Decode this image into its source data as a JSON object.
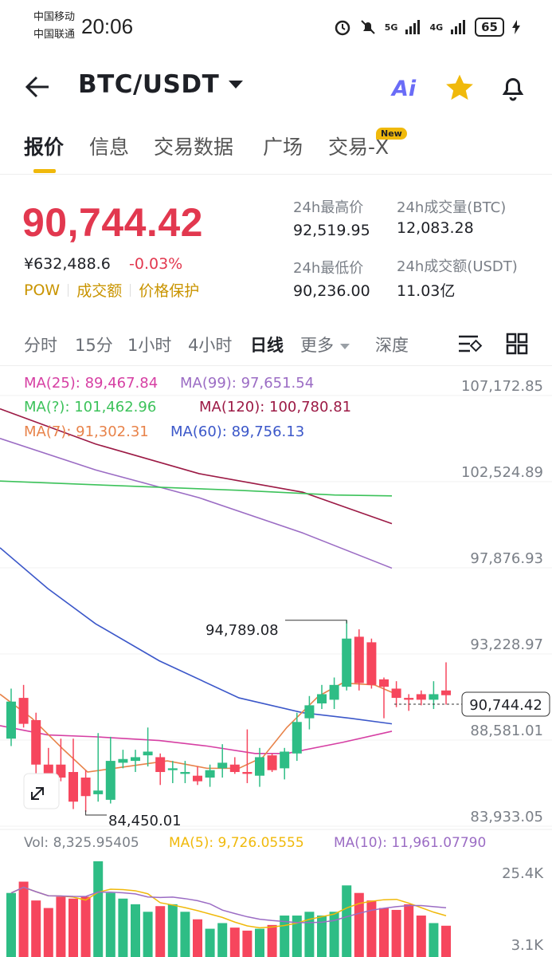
{
  "status_bar": {
    "carrier1": "中国移动",
    "carrier2": "中国联通",
    "time": "20:06",
    "net1": "5G",
    "net2": "4G",
    "battery": "65"
  },
  "header": {
    "pair": "BTC/USDT",
    "ai_label": "Ai",
    "icons": [
      "back-arrow-icon",
      "ai-icon",
      "star-icon",
      "bell-icon"
    ]
  },
  "tabs": [
    {
      "label": "报价",
      "active": true
    },
    {
      "label": "信息"
    },
    {
      "label": "交易数据"
    },
    {
      "label": "广场"
    },
    {
      "label": "交易-X",
      "badge": "New"
    }
  ],
  "price": {
    "last": "90,744.42",
    "cny": "¥632,488.6",
    "change": "-0.03%",
    "tags": [
      "POW",
      "成交额",
      "价格保护"
    ],
    "stats": {
      "high_label": "24h最高价",
      "high": "92,519.95",
      "low_label": "24h最低价",
      "low": "90,236.00",
      "vol_btc_label": "24h成交量(BTC)",
      "vol_btc": "12,083.28",
      "vol_usdt_label": "24h成交额(USDT)",
      "vol_usdt": "11.03亿"
    }
  },
  "intervals": [
    "分时",
    "15分",
    "1小时",
    "4小时",
    "日线",
    "更多",
    "深度"
  ],
  "active_interval": "日线",
  "ma_legend": {
    "ma25": "MA(25): 89,467.84",
    "ma99": "MA(99): 97,651.54",
    "ma_hidden": "MA(?): 101,462.96",
    "ma120": "MA(120): 100,780.81",
    "ma7": "MA(7): 91,302.31",
    "ma60": "MA(60): 89,756.13"
  },
  "colors": {
    "up": "#2ebd85",
    "down": "#f6465d",
    "accent": "#f0b90b",
    "ma7": "#e8834a",
    "ma25": "#d63fa3",
    "ma99": "#9b6cc4",
    "ma60": "#3b57c9",
    "ma120": "#9c1a45",
    "ma_green": "#3cc25a",
    "vol_ma5": "#f0b90b",
    "vol_ma10": "#9b6cc4"
  },
  "chart_data": {
    "type": "candlestick",
    "y_ticks": [
      "107,172.85",
      "102,524.89",
      "97,876.93",
      "93,228.97",
      "88,581.01",
      "83,933.05"
    ],
    "ylim": [
      83933.05,
      107172.85
    ],
    "annotations": {
      "high_label": "94,789.08",
      "low_label": "84,450.01",
      "current_price": "90,744.42"
    },
    "candles": [
      {
        "o": 88400,
        "h": 91100,
        "l": 88000,
        "c": 90400
      },
      {
        "o": 90600,
        "h": 91300,
        "l": 89000,
        "c": 89200
      },
      {
        "o": 89400,
        "h": 89800,
        "l": 86500,
        "c": 87000
      },
      {
        "o": 87000,
        "h": 87900,
        "l": 86100,
        "c": 86500
      },
      {
        "o": 87000,
        "h": 88400,
        "l": 86100,
        "c": 86300
      },
      {
        "o": 86600,
        "h": 88400,
        "l": 84600,
        "c": 85000
      },
      {
        "o": 86300,
        "h": 86700,
        "l": 84450.01,
        "c": 85300
      },
      {
        "o": 85400,
        "h": 88700,
        "l": 85000,
        "c": 85600
      },
      {
        "o": 85100,
        "h": 88500,
        "l": 84900,
        "c": 87200
      },
      {
        "o": 87100,
        "h": 87800,
        "l": 86800,
        "c": 87300
      },
      {
        "o": 87200,
        "h": 87800,
        "l": 86600,
        "c": 87400
      },
      {
        "o": 87500,
        "h": 89000,
        "l": 86900,
        "c": 87700
      },
      {
        "o": 87400,
        "h": 87600,
        "l": 85900,
        "c": 86600
      },
      {
        "o": 86700,
        "h": 87200,
        "l": 86000,
        "c": 86800
      },
      {
        "o": 86500,
        "h": 87200,
        "l": 86000,
        "c": 86600
      },
      {
        "o": 86400,
        "h": 86900,
        "l": 85900,
        "c": 86100
      },
      {
        "o": 86300,
        "h": 87000,
        "l": 85800,
        "c": 86700
      },
      {
        "o": 86800,
        "h": 88100,
        "l": 86300,
        "c": 87100
      },
      {
        "o": 87000,
        "h": 87400,
        "l": 86500,
        "c": 86600
      },
      {
        "o": 86600,
        "h": 88900,
        "l": 86000,
        "c": 86500
      },
      {
        "o": 86400,
        "h": 87900,
        "l": 85800,
        "c": 87400
      },
      {
        "o": 87500,
        "h": 87600,
        "l": 86600,
        "c": 86700
      },
      {
        "o": 86800,
        "h": 87900,
        "l": 86200,
        "c": 87700
      },
      {
        "o": 87600,
        "h": 89800,
        "l": 87200,
        "c": 89300
      },
      {
        "o": 89500,
        "h": 90700,
        "l": 88900,
        "c": 90200
      },
      {
        "o": 90300,
        "h": 91300,
        "l": 90000,
        "c": 90800
      },
      {
        "o": 90500,
        "h": 91700,
        "l": 90000,
        "c": 91300
      },
      {
        "o": 91200,
        "h": 94789.08,
        "l": 91000,
        "c": 93800
      },
      {
        "o": 93900,
        "h": 94300,
        "l": 91000,
        "c": 91400
      },
      {
        "o": 93600,
        "h": 93800,
        "l": 91100,
        "c": 91300
      },
      {
        "o": 91600,
        "h": 91700,
        "l": 89500,
        "c": 91200
      },
      {
        "o": 91100,
        "h": 91500,
        "l": 90100,
        "c": 90600
      },
      {
        "o": 90600,
        "h": 90800,
        "l": 89900,
        "c": 90500
      },
      {
        "o": 90800,
        "h": 91000,
        "l": 90200,
        "c": 90500
      },
      {
        "o": 90500,
        "h": 91500,
        "l": 90000,
        "c": 90800
      },
      {
        "o": 91000,
        "h": 92519.95,
        "l": 90236,
        "c": 90744.42
      }
    ],
    "volume": {
      "legend_vol": "Vol: 8,325.95405",
      "legend_ma5": "MA(5): 9,726.05555",
      "legend_ma10": "MA(10): 11,961.07790",
      "y_ticks": [
        "25.4K",
        "3.1K"
      ],
      "values": [
        17000,
        20000,
        15000,
        13000,
        16000,
        15500,
        16000,
        25400,
        17000,
        15500,
        14000,
        12000,
        13500,
        14000,
        12000,
        10000,
        7500,
        9000,
        7800,
        7000,
        7500,
        8500,
        11000,
        11000,
        12000,
        11000,
        12000,
        19000,
        17000,
        15000,
        13000,
        12500,
        14000,
        11000,
        9000,
        8300
      ]
    }
  }
}
